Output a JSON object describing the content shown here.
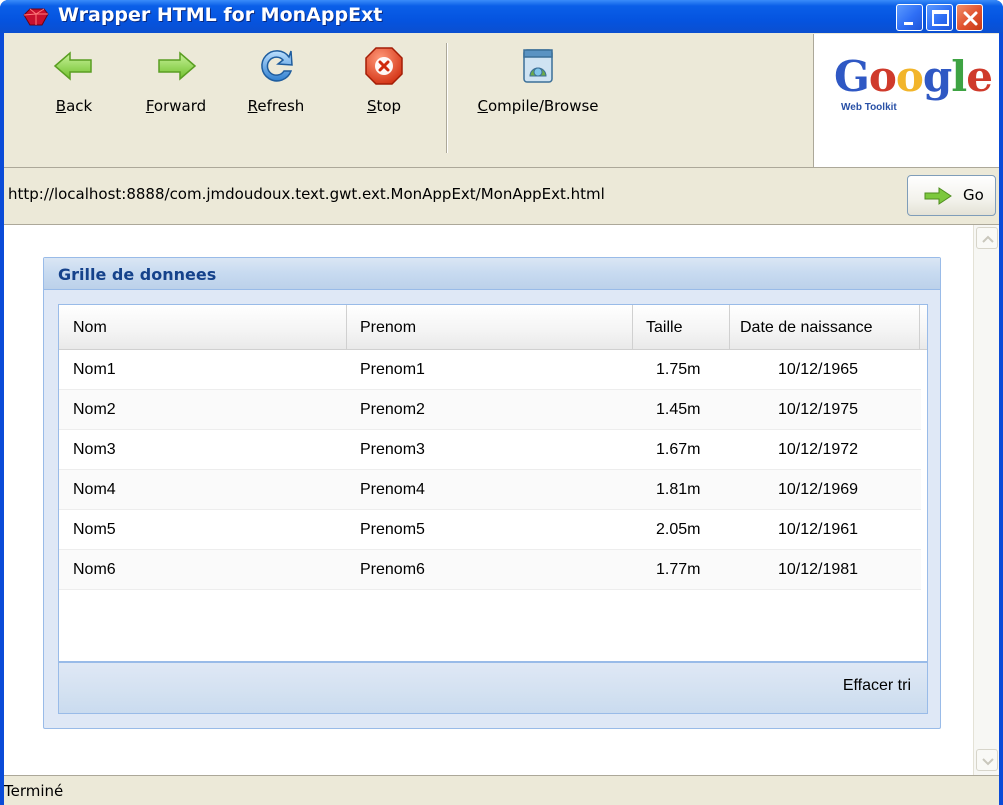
{
  "window": {
    "title": "Wrapper HTML for MonAppExt",
    "app_icon": "red-gem-icon"
  },
  "toolbar": {
    "buttons": [
      {
        "label": "Back",
        "access_key": "B",
        "rest": "ack",
        "icon": "back-arrow-icon"
      },
      {
        "label": "Forward",
        "access_key": "F",
        "rest": "orward",
        "icon": "forward-arrow-icon"
      },
      {
        "label": "Refresh",
        "access_key": "R",
        "rest": "efresh",
        "icon": "refresh-icon"
      },
      {
        "label": "Stop",
        "access_key": "S",
        "rest": "top",
        "icon": "stop-icon"
      },
      {
        "label": "Compile/Browse",
        "access_key": "C",
        "rest": "ompile/Browse",
        "icon": "compile-browse-icon"
      }
    ],
    "logo": {
      "text": "Google",
      "subtitle": "Web Toolkit"
    }
  },
  "address_bar": {
    "url": "http://localhost:8888/com.jmdoudoux.text.gwt.ext.MonAppExt/MonAppExt.html",
    "go_label": "Go"
  },
  "panel": {
    "title": "Grille de donnees",
    "columns": [
      "Nom",
      "Prenom",
      "Taille",
      "Date de naissance"
    ],
    "rows": [
      [
        "Nom1",
        "Prenom1",
        "1.75m",
        "10/12/1965"
      ],
      [
        "Nom2",
        "Prenom2",
        "1.45m",
        "10/12/1975"
      ],
      [
        "Nom3",
        "Prenom3",
        "1.67m",
        "10/12/1972"
      ],
      [
        "Nom4",
        "Prenom4",
        "1.81m",
        "10/12/1969"
      ],
      [
        "Nom5",
        "Prenom5",
        "2.05m",
        "10/12/1961"
      ],
      [
        "Nom6",
        "Prenom6",
        "1.77m",
        "10/12/1981"
      ]
    ],
    "clear_sort_label": "Effacer tri"
  },
  "status": {
    "text": "Terminé"
  },
  "colors": {
    "titlebar": "#0554e0",
    "panel_header_text": "#15428b",
    "panel_border": "#99bbe8"
  }
}
